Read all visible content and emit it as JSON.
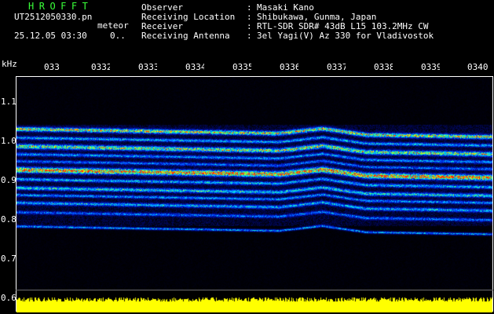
{
  "header": {
    "brand": "HROFFT",
    "file_name": "UT2512050330.pn",
    "date_time": "25.12.05 03:30",
    "mode_label": "meteor",
    "mode_count": "0.."
  },
  "station": {
    "rows": [
      {
        "label": "Observer",
        "value": "Masaki Kano"
      },
      {
        "label": "Receiving Location",
        "value": "Shibukawa, Gunma, Japan"
      },
      {
        "label": "Receiver",
        "value": "RTL-SDR SDR# 43dB L15 103.2MHz CW"
      },
      {
        "label": "Receiving Antenna",
        "value": "3el Yagi(V) Az 330 for Vladivostok"
      }
    ],
    "separator": ":"
  },
  "axes": {
    "y_unit": "kHz",
    "time_ticks": [
      "033",
      "0332",
      "0333",
      "0334",
      "0335",
      "0336",
      "0337",
      "0338",
      "0339",
      "0340"
    ],
    "freq_ticks": [
      "1.1",
      "1.0",
      "0.9",
      "0.8",
      "0.7",
      "0.6"
    ]
  },
  "colors": {
    "background": "#000000",
    "brand": "#39ff39",
    "noise_bar": "#ffff00",
    "low_signal": "#0a14c8",
    "high_signal": "#ff3000"
  }
}
